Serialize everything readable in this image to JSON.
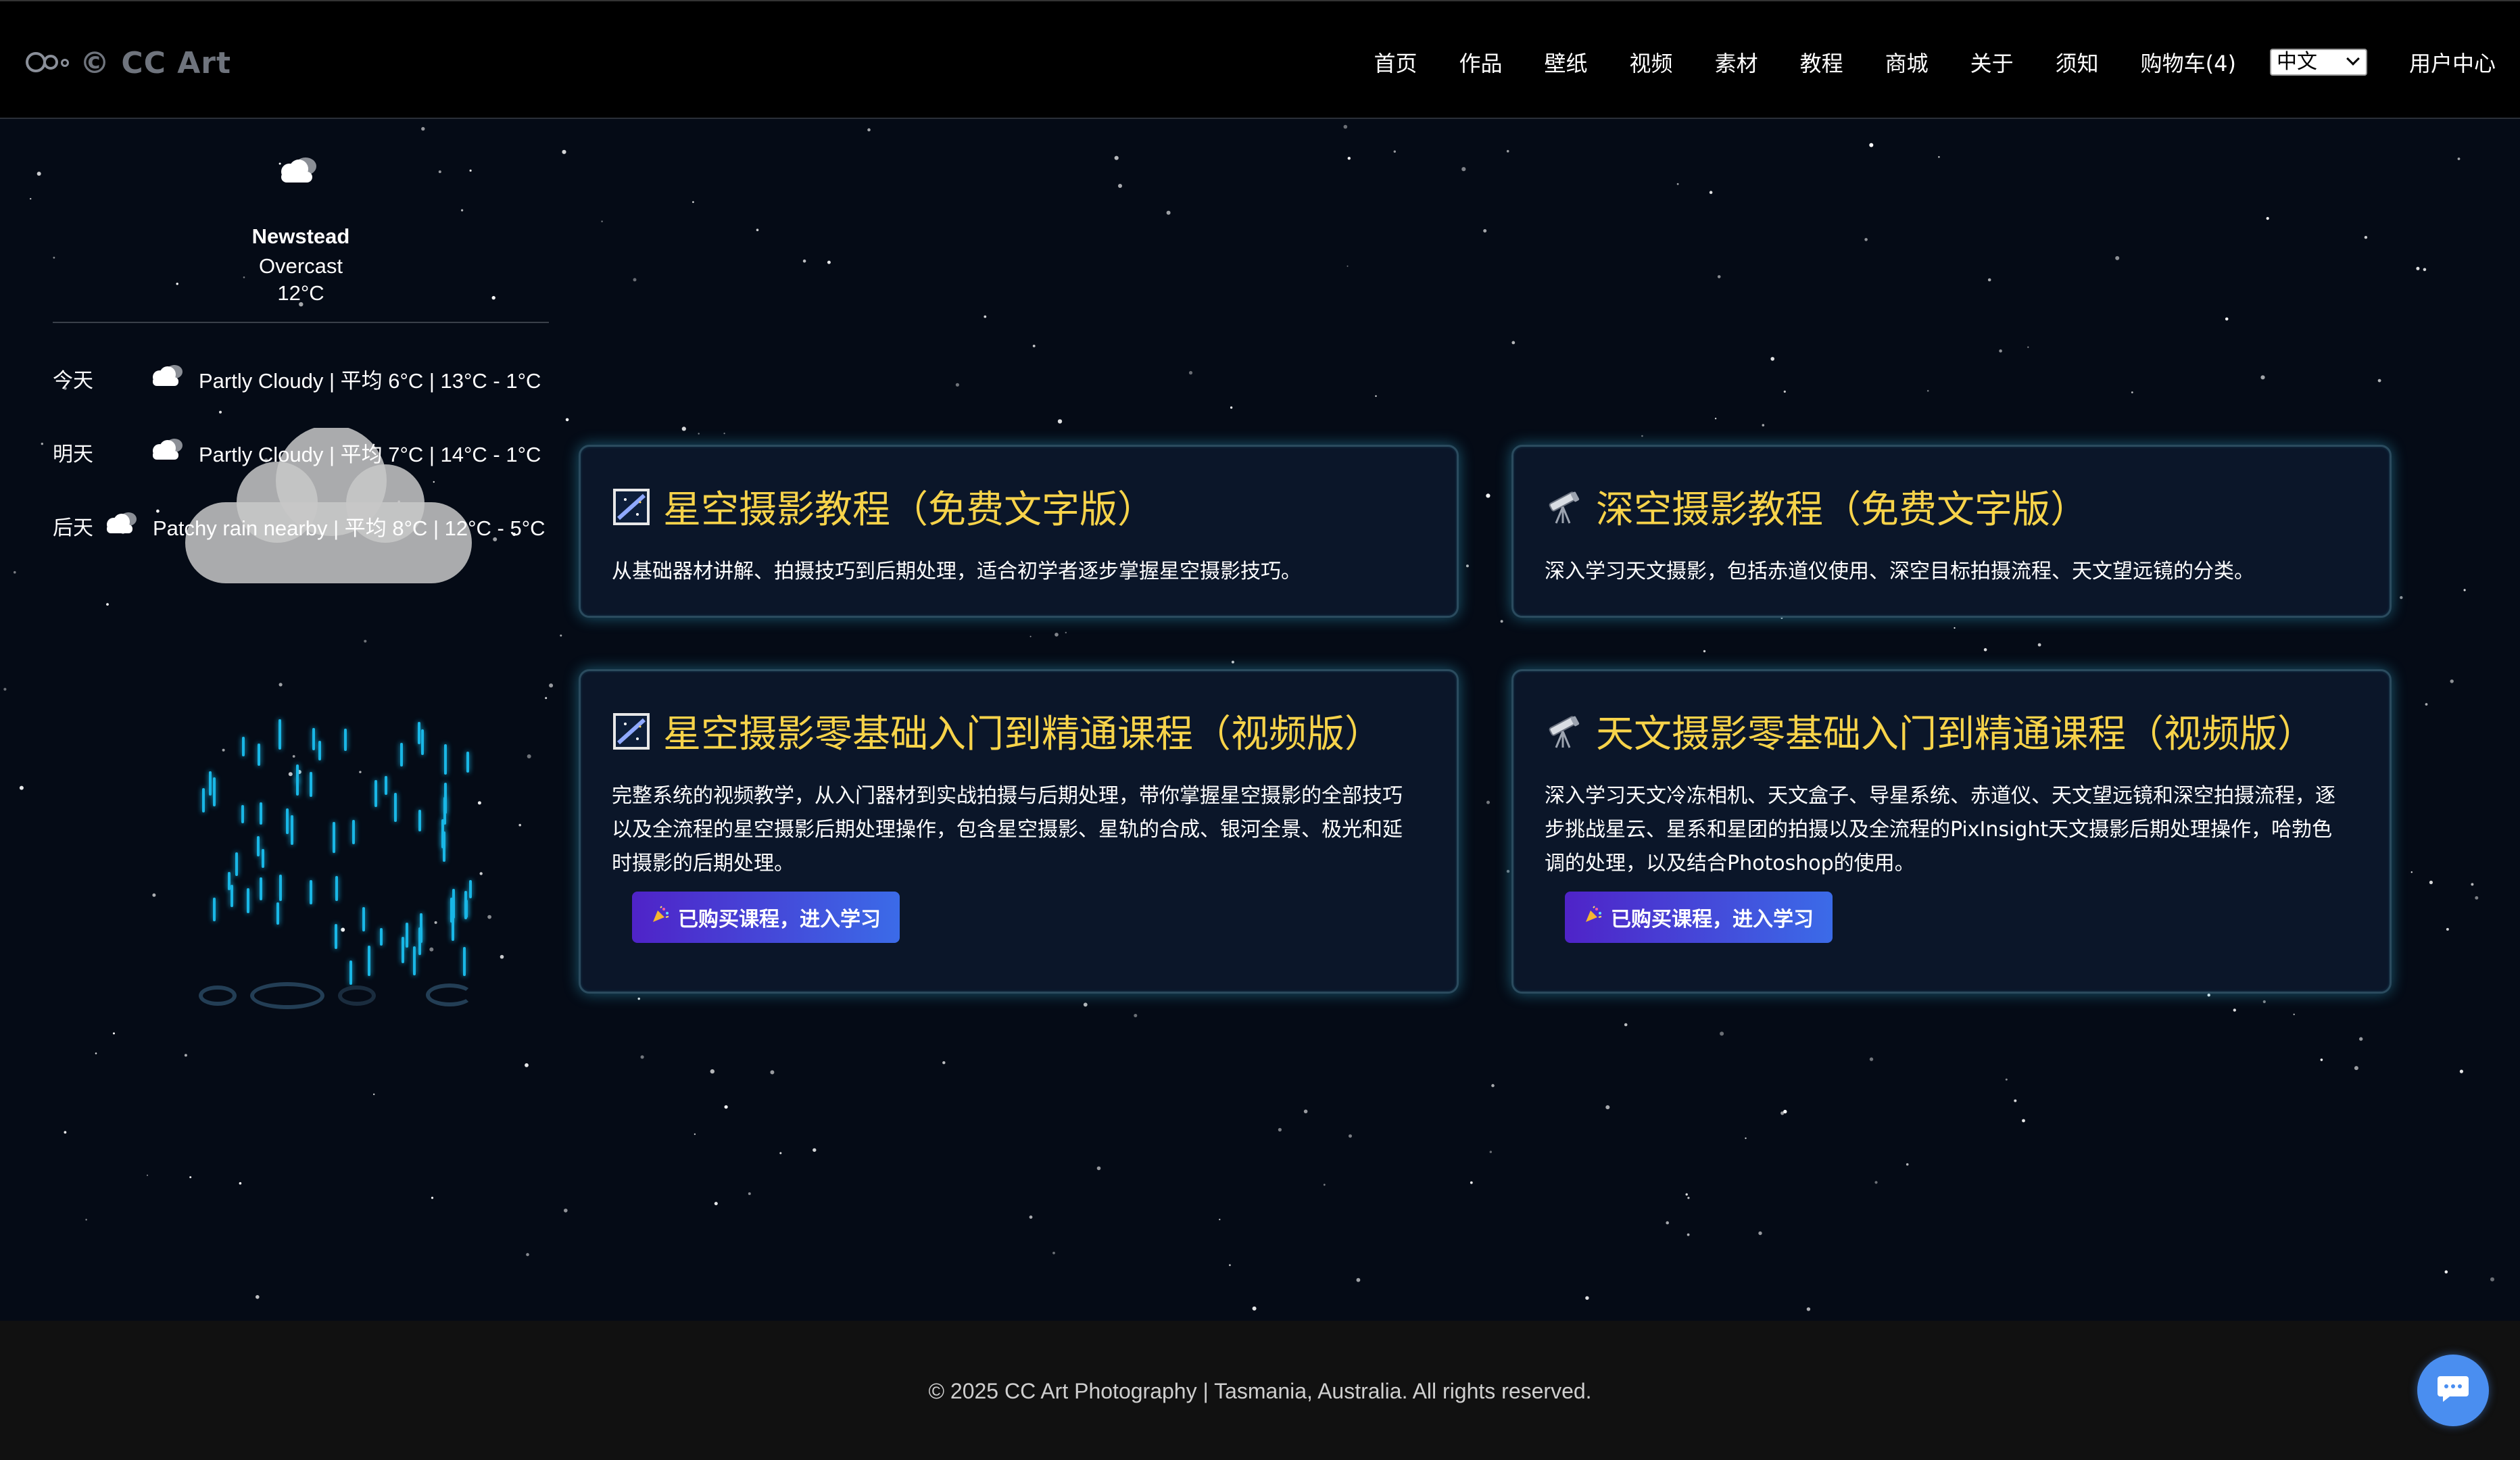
{
  "header": {
    "logo_text": "© CC Art",
    "nav": [
      "首页",
      "作品",
      "壁纸",
      "视频",
      "素材",
      "教程",
      "商城",
      "关于",
      "须知",
      "购物车(4)"
    ],
    "language": "中文",
    "user_center": "用户中心"
  },
  "weather": {
    "city": "Newstead",
    "condition": "Overcast",
    "temperature": "12°C",
    "forecast": [
      {
        "day": "今天",
        "text": "Partly Cloudy | 平均 6°C | 13°C - 1°C",
        "icon": "partly-cloudy-icon"
      },
      {
        "day": "明天",
        "text": "Partly Cloudy | 平均 7°C | 14°C - 1°C",
        "icon": "partly-cloudy-icon"
      },
      {
        "day": "后天",
        "text": "Patchy rain nearby | 平均 8°C | 12°C - 5°C",
        "icon": "cloud-rain-icon"
      }
    ]
  },
  "courses": [
    {
      "title": "星空摄影教程（免费文字版）",
      "icon": "milky-way-icon",
      "desc": "从基础器材讲解、拍摄技巧到后期处理，适合初学者逐步掌握星空摄影技巧。"
    },
    {
      "title": "深空摄影教程（免费文字版）",
      "icon": "telescope-icon",
      "desc": "深入学习天文摄影，包括赤道仪使用、深空目标拍摄流程、天文望远镜的分类。"
    },
    {
      "title": "星空摄影零基础入门到精通课程（视频版）",
      "icon": "milky-way-icon",
      "desc": "完整系统的视频教学，从入门器材到实战拍摄与后期处理，带你掌握星空摄影的全部技巧以及全流程的星空摄影后期处理操作，包含星空摄影、星轨的合成、银河全景、极光和延时摄影的后期处理。",
      "button": "已购买课程，进入学习"
    },
    {
      "title": "天文摄影零基础入门到精通课程（视频版）",
      "icon": "telescope-icon",
      "desc": "深入学习天文冷冻相机、天文盒子、导星系统、赤道仪、天文望远镜和深空拍摄流程，逐步挑战星云、星系和星团的拍摄以及全流程的PixInsight天文摄影后期处理操作，哈勃色调的处理，以及结合Photoshop的使用。",
      "button": "已购买课程，进入学习"
    }
  ],
  "footer": {
    "text": "© 2025 CC Art Photography | Tasmania, Australia. All rights reserved."
  }
}
